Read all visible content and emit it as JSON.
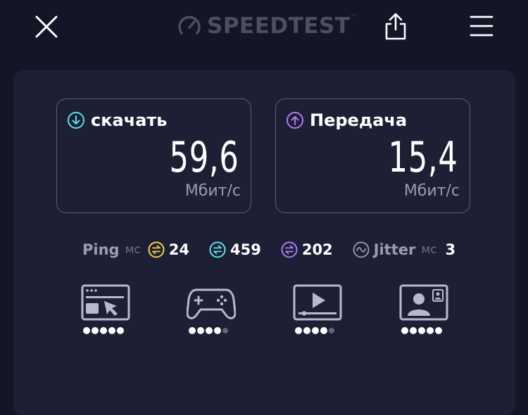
{
  "app": {
    "logo_text": "SPEEDTEST",
    "logo_mark": "™"
  },
  "download": {
    "label": "скачать",
    "value": "59,6",
    "unit": "Мбит/с",
    "icon": "download-arrow-icon",
    "color": "#5ee0e6"
  },
  "upload": {
    "label": "Передача",
    "value": "15,4",
    "unit": "Мбит/с",
    "icon": "upload-arrow-icon",
    "color": "#b17bf2"
  },
  "ping": {
    "label": "Ping",
    "unit": "мс",
    "idle": {
      "value": "24",
      "color": "#f4d24b"
    },
    "download": {
      "value": "459",
      "color": "#5ee0e6"
    },
    "upload": {
      "value": "202",
      "color": "#b17bf2"
    }
  },
  "jitter": {
    "label": "Jitter",
    "unit": "мс",
    "value": "3"
  },
  "quality": [
    {
      "name": "browsing",
      "icon": "browsing-icon",
      "rating": 5,
      "max": 5
    },
    {
      "name": "gaming",
      "icon": "gamepad-icon",
      "rating": 4,
      "max": 5
    },
    {
      "name": "video",
      "icon": "video-play-icon",
      "rating": 4,
      "max": 5
    },
    {
      "name": "video-call",
      "icon": "video-call-icon",
      "rating": 5,
      "max": 5
    }
  ]
}
